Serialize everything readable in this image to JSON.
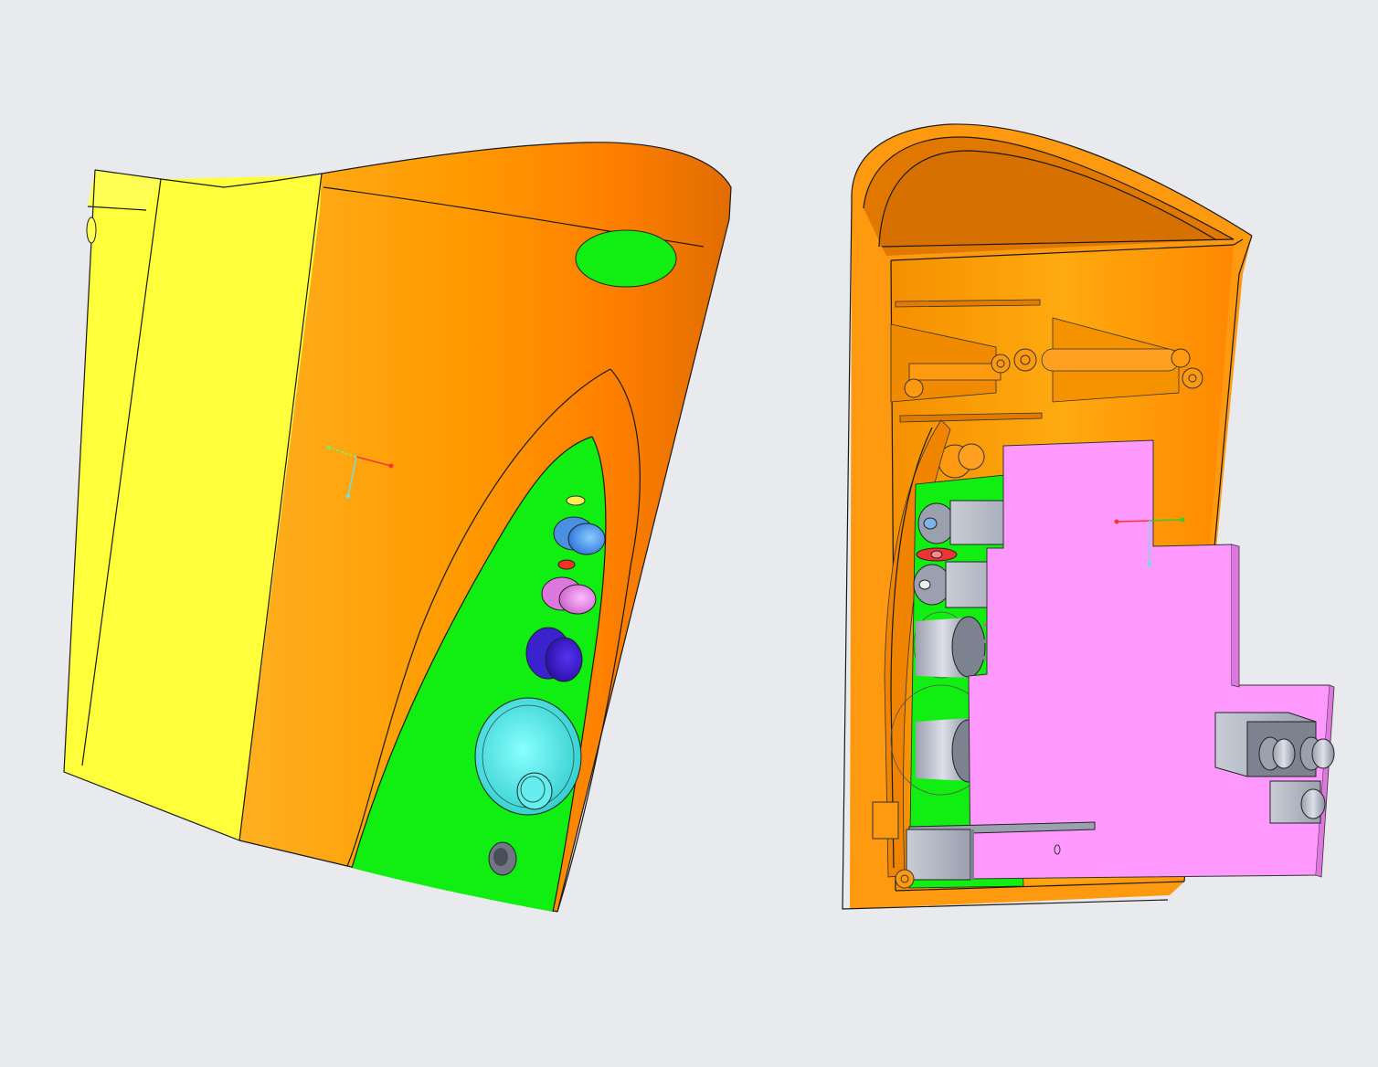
{
  "viewport": {
    "background": "#e8eaee"
  },
  "colors": {
    "yellow": "#ffff3c",
    "orange": "#ff9900",
    "orange_dark": "#e67300",
    "green": "#00ee00",
    "pink": "#ff99ff",
    "light_blue": "#66aaff",
    "dark_blue": "#4422dd",
    "cyan": "#55eeee",
    "gray": "#a0a8b8"
  },
  "models": [
    {
      "name": "enclosure-front-exterior"
    },
    {
      "name": "enclosure-open-interior"
    }
  ],
  "icons": {
    "triad": "coordinate-triad-icon"
  }
}
